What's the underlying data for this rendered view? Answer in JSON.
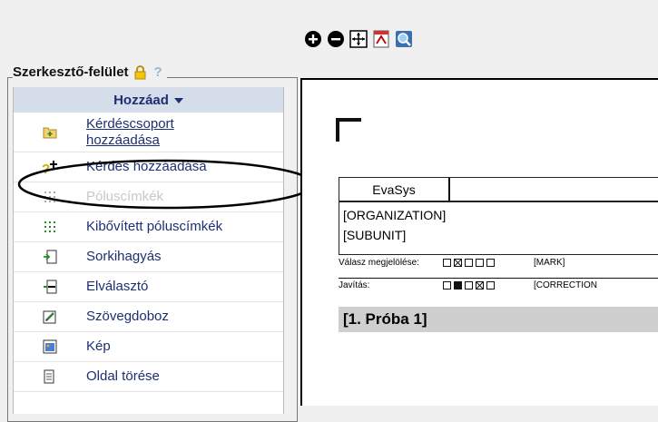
{
  "toolbar": {
    "buttons": [
      {
        "icon": "zoom-in-icon"
      },
      {
        "icon": "zoom-out-icon"
      },
      {
        "icon": "fit-page-icon"
      },
      {
        "icon": "pdf-icon"
      },
      {
        "icon": "preview-icon"
      }
    ]
  },
  "panel": {
    "title": "Szerkesztő-felület",
    "help": "?",
    "add_label": "Hozzáad",
    "items": [
      {
        "label": "Kérdéscsoport hozzáadása",
        "icon": "folder-add-icon"
      },
      {
        "label": "Kérdés hozzáadása",
        "icon": "question-add-icon"
      },
      {
        "label": "Póluscímkék",
        "icon": "pole-labels-icon"
      },
      {
        "label": "Kibővített póluscímkék",
        "icon": "extended-pole-labels-icon"
      },
      {
        "label": "Sorkihagyás",
        "icon": "line-skip-icon"
      },
      {
        "label": "Elválasztó",
        "icon": "separator-icon"
      },
      {
        "label": "Szövegdoboz",
        "icon": "textbox-icon"
      },
      {
        "label": "Kép",
        "icon": "image-icon"
      },
      {
        "label": "Oldal törése",
        "icon": "page-break-icon"
      }
    ]
  },
  "preview": {
    "header_cell": "EvaSys",
    "org_lines": [
      "[ORGANIZATION]",
      "[SUBUNIT]"
    ],
    "mark_label": "Válasz megjelölése:",
    "mark_tag": "[MARK]",
    "correction_label": "Javítás:",
    "correction_tag": "[CORRECTION",
    "section_title": "[1. Próba 1]"
  },
  "colors": {
    "accent": "#1d2f73",
    "header_bg": "#d5dcea"
  }
}
